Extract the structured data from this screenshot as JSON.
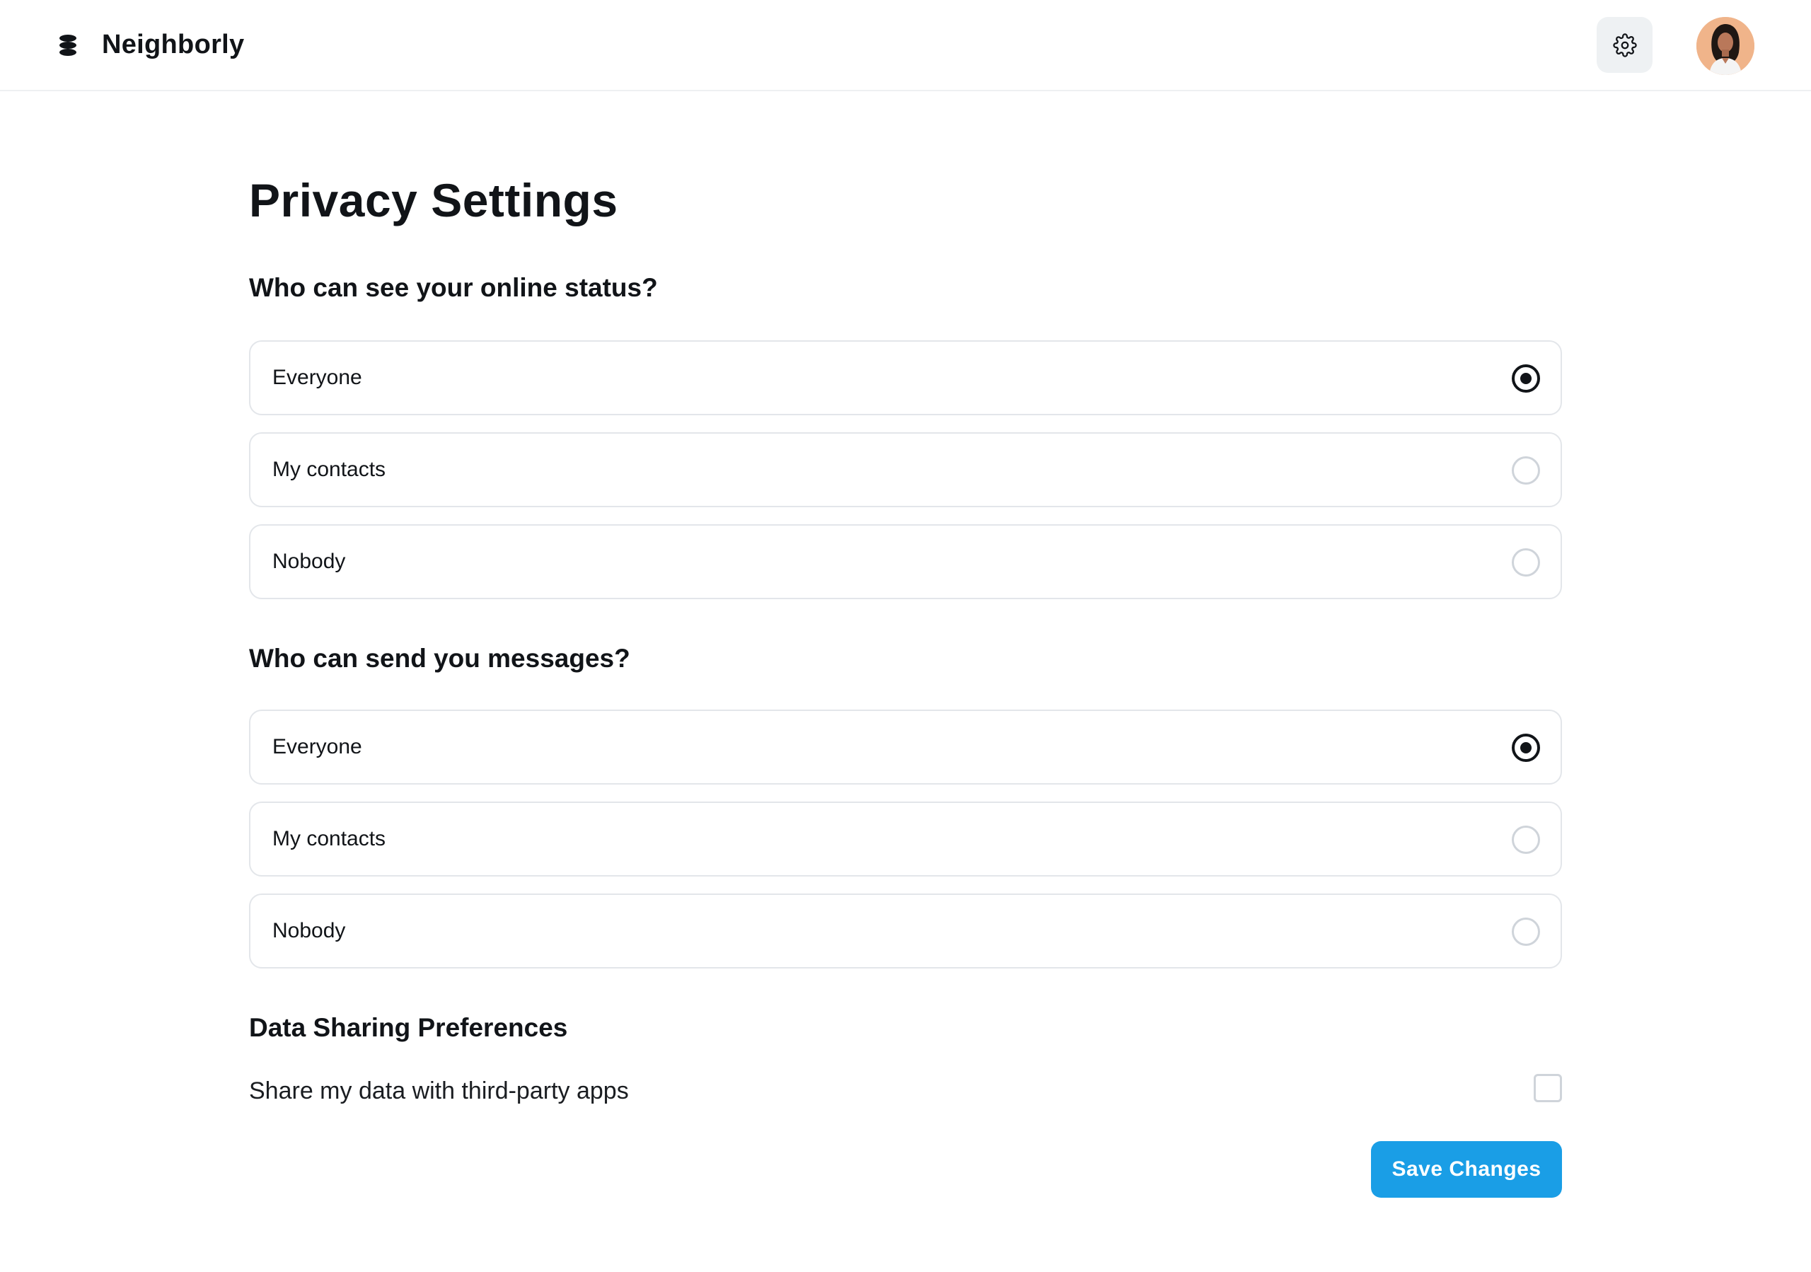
{
  "header": {
    "brand": "Neighborly",
    "logo_icon": "stacked-discs-icon",
    "settings_icon": "gear-icon",
    "avatar_icon": "user-avatar"
  },
  "page": {
    "title": "Privacy Settings"
  },
  "online_status": {
    "question": "Who can see your online status?",
    "selected": "Everyone",
    "options": [
      {
        "label": "Everyone",
        "checked": true
      },
      {
        "label": "My contacts",
        "checked": false
      },
      {
        "label": "Nobody",
        "checked": false
      }
    ]
  },
  "messages": {
    "question": "Who can send you messages?",
    "selected": "Everyone",
    "options": [
      {
        "label": "Everyone",
        "checked": true
      },
      {
        "label": "My contacts",
        "checked": false
      },
      {
        "label": "Nobody",
        "checked": false
      }
    ]
  },
  "data_sharing": {
    "title": "Data Sharing Preferences",
    "share_label": "Share my data with third-party apps",
    "share_checked": false
  },
  "actions": {
    "save_label": "Save Changes"
  },
  "colors": {
    "accent": "#1a9ee6",
    "text": "#111418",
    "border": "#e3e6ea"
  }
}
